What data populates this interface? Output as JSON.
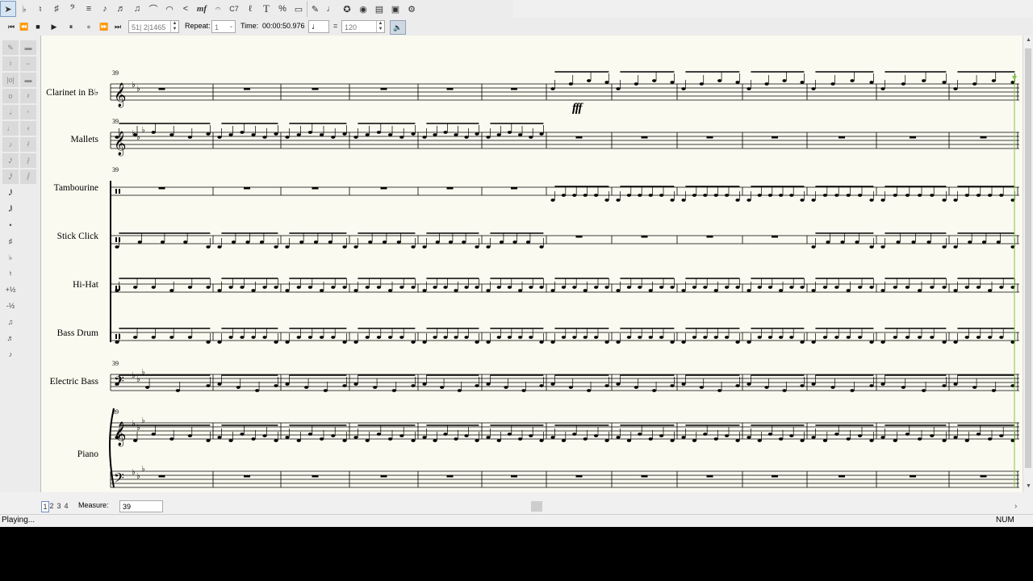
{
  "toolbar1": {
    "tools": [
      "select-icon",
      "flat-icon",
      "natural-icon",
      "sharp-icon",
      "bass-clef-icon",
      "staff-icon",
      "eighth-note-icon",
      "sixteenth-note-icon",
      "beam-icon",
      "slur-icon",
      "tie-icon",
      "crescendo-icon",
      "dynamics-icon",
      "chord-symbol-icon",
      "trill-icon",
      "text-icon",
      "percent-icon",
      "page-icon",
      "tools-icon",
      "note-icon",
      "shape-icon",
      "drum-icon",
      "keyboard-icon",
      "mixer-icon",
      "settings-icon"
    ]
  },
  "playback": {
    "position": "51| 2|1465",
    "repeat_label": "Repeat:",
    "repeat_value": "1",
    "time_label": "Time:",
    "time_value": "00:00:50.976",
    "equals": "=",
    "tempo": "120"
  },
  "score": {
    "measure_number": "39",
    "dynamic_marking": "fff",
    "instruments": [
      "Clarinet in B♭",
      "Mallets",
      "Tambourine",
      "Stick Click",
      "Hi-Hat",
      "Bass Drum",
      "Electric Bass",
      "Piano"
    ]
  },
  "bottom": {
    "pages": [
      "1",
      "2",
      "3",
      "4"
    ],
    "measure_label": "Measure:",
    "measure_value": "39"
  },
  "status": {
    "message": "Playing...",
    "num_indicator": "NUM"
  }
}
